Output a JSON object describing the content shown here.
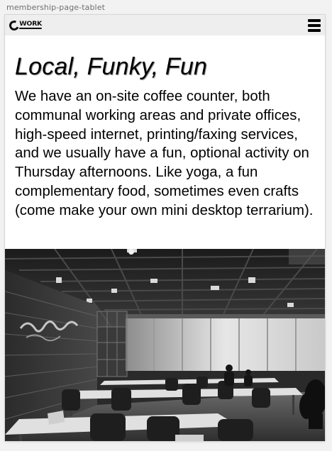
{
  "frame_label": "membership-page-tablet",
  "nav": {
    "logo_text": "WORK",
    "logo_icon": "coworking-logo",
    "menu_icon": "hamburger-menu-icon"
  },
  "main": {
    "headline": "Local, Funky, Fun",
    "body": "We have an on-site coffee counter, both communal working areas and private offices, high-speed internet, printing/faxing services, and we usually have a fun, optional activity on Thursday afternoons. Like yoga, a fun complementary food, sometimes even crafts (come make your own mini desktop terrarium)."
  },
  "hero_image": {
    "subject": "coworking-office-photo",
    "tone": "grayscale"
  },
  "colors": {
    "frame_background": "#f2f2f2",
    "navbar_background": "#eeeeee",
    "page_background": "#ffffff",
    "text": "#000000"
  }
}
